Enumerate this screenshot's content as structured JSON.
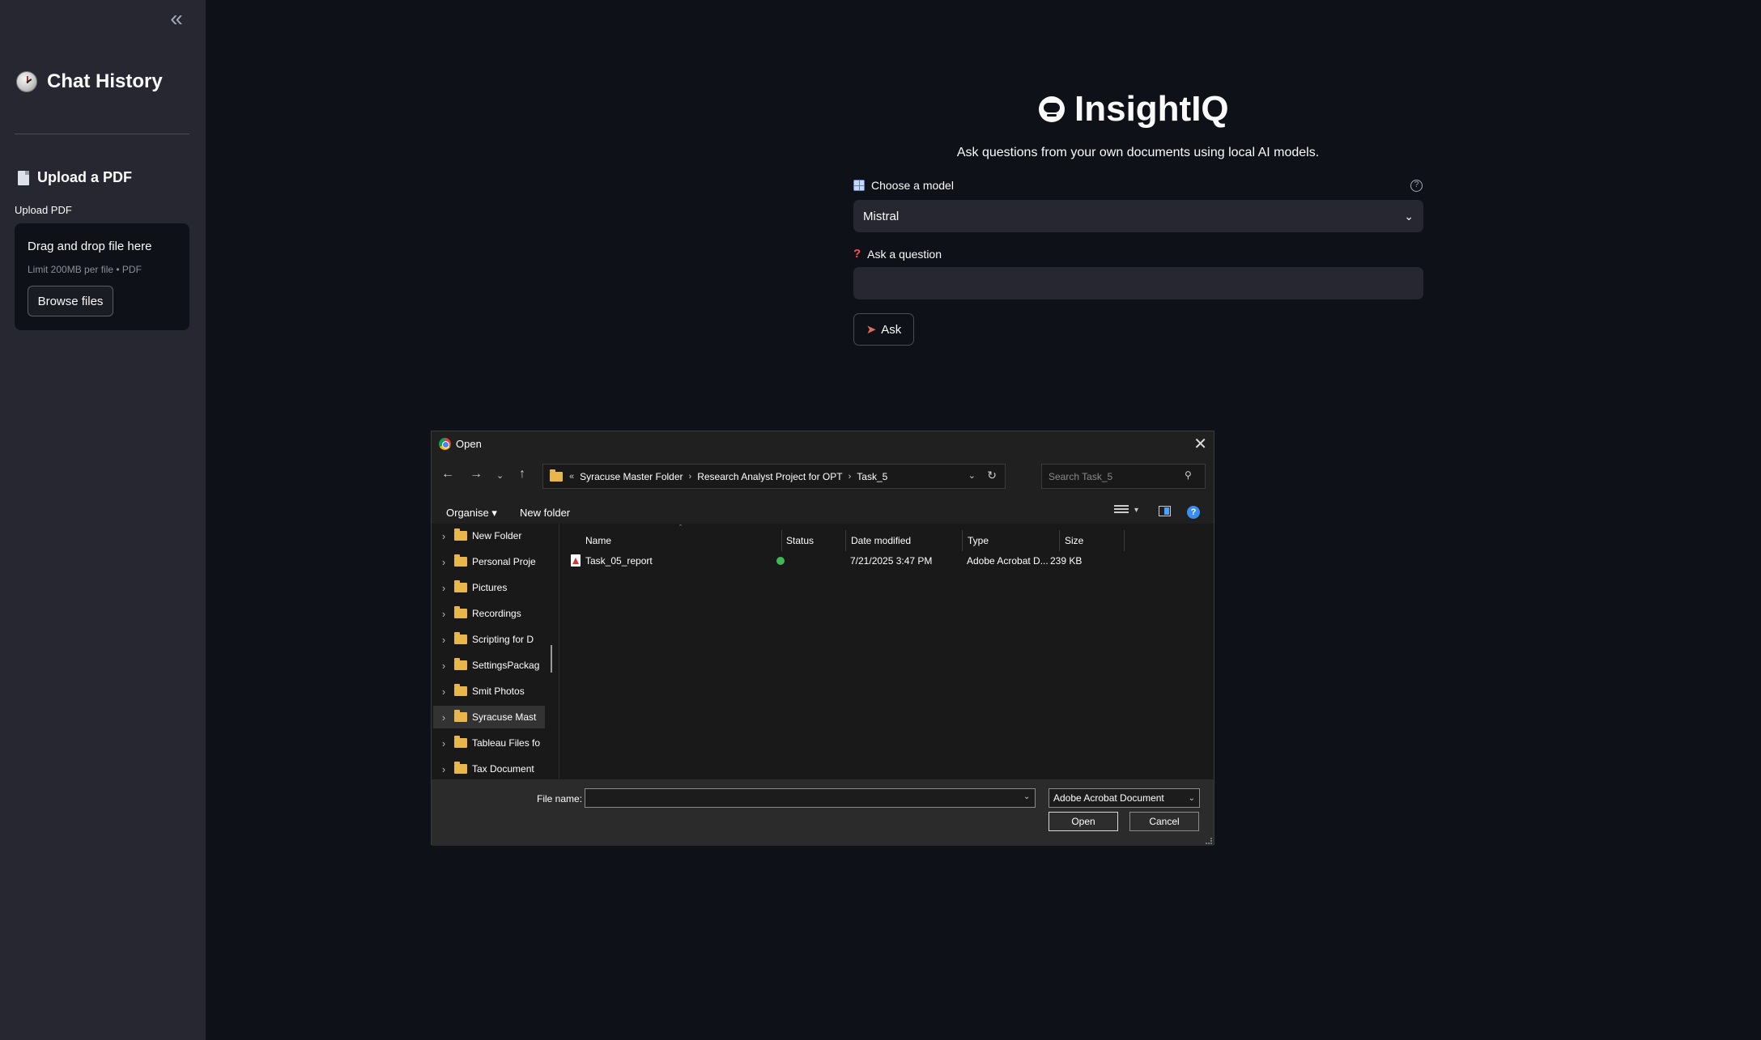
{
  "sidebar": {
    "collapse_glyph": "«",
    "history_title": "Chat History",
    "upload_heading": "Upload a PDF",
    "upload_label": "Upload PDF",
    "dropzone_title": "Drag and drop file here",
    "dropzone_limit": "Limit 200MB per file • PDF",
    "browse_button": "Browse files"
  },
  "main": {
    "title": "InsightIQ",
    "subtitle": "Ask questions from your own documents using local AI models.",
    "model_label": "Choose a model",
    "model_value": "Mistral",
    "question_label": "Ask a question",
    "question_value": "",
    "ask_button": "Ask"
  },
  "dialog": {
    "title": "Open",
    "breadcrumb_prefix": "«",
    "breadcrumbs": [
      "Syracuse Master Folder",
      "Research Analyst Project for OPT",
      "Task_5"
    ],
    "search_placeholder": "Search Task_5",
    "toolbar": {
      "organise": "Organise",
      "new_folder": "New folder"
    },
    "nav_items": [
      {
        "label": "New Folder",
        "selected": false
      },
      {
        "label": "Personal Proje",
        "selected": false
      },
      {
        "label": "Pictures",
        "selected": false
      },
      {
        "label": "Recordings",
        "selected": false
      },
      {
        "label": "Scripting for D",
        "selected": false
      },
      {
        "label": "SettingsPackag",
        "selected": false
      },
      {
        "label": "Smit Photos",
        "selected": false
      },
      {
        "label": "Syracuse Mast",
        "selected": true
      },
      {
        "label": "Tableau Files fo",
        "selected": false
      },
      {
        "label": "Tax Document",
        "selected": false
      }
    ],
    "columns": [
      "Name",
      "Status",
      "Date modified",
      "Type",
      "Size"
    ],
    "files": [
      {
        "name": "Task_05_report",
        "status": "synced",
        "date_modified": "7/21/2025 3:47 PM",
        "type": "Adobe Acrobat D...",
        "size": "239 KB"
      }
    ],
    "file_name_label": "File name:",
    "file_name_value": "",
    "file_type": "Adobe Acrobat Document",
    "open_button": "Open",
    "cancel_button": "Cancel"
  },
  "colors": {
    "background": "#0e1117",
    "sidebar": "#262730",
    "dialog": "#202020",
    "status_ok": "#3fb950"
  }
}
